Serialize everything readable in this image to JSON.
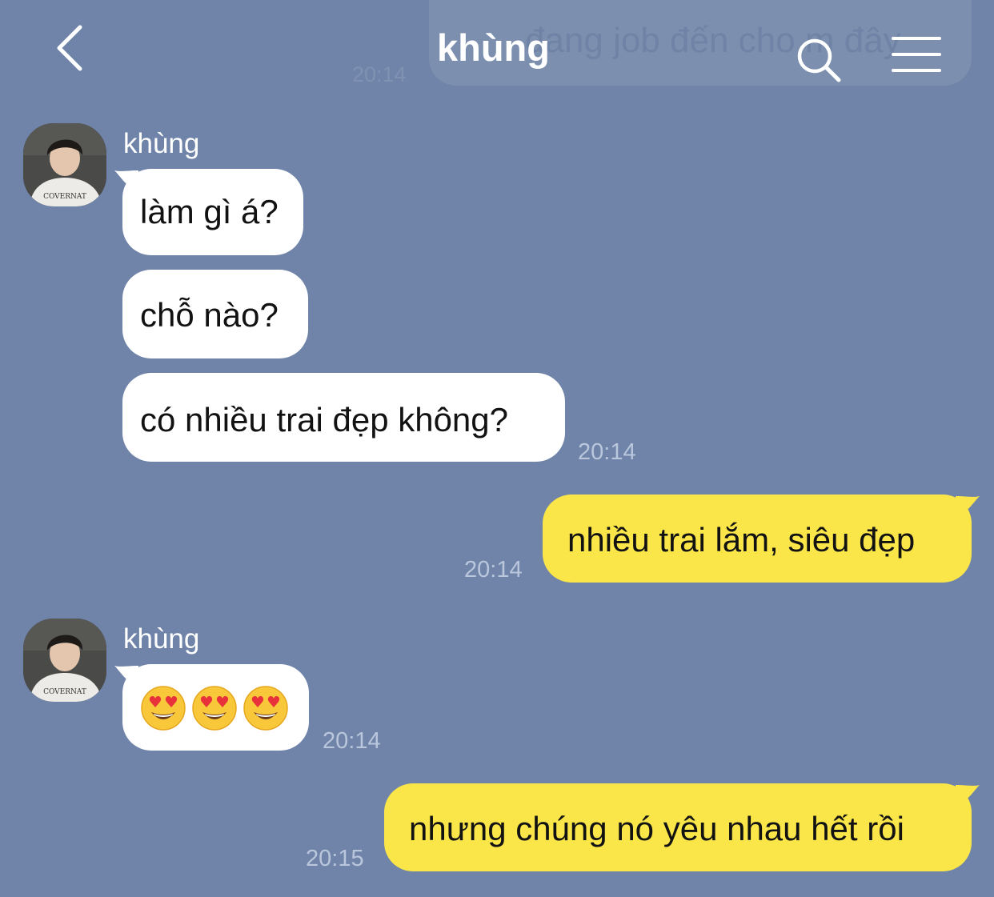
{
  "header": {
    "title": "khùng",
    "pinned_preview_text": "đang job đến cho m đây",
    "pinned_preview_time": "20:14"
  },
  "icons": {
    "back": "chevron-left-icon",
    "search": "search-icon",
    "menu": "hamburger-menu-icon",
    "avatar": "profile-photo",
    "emoji": "heart-eyes-emoji"
  },
  "colors": {
    "background": "#6f84a8",
    "incoming_bubble": "#ffffff",
    "outgoing_bubble": "#fbe64a",
    "timestamp": "#b9c6dc"
  },
  "messages": [
    {
      "sender": "khùng",
      "direction": "incoming",
      "text": "làm gì á?"
    },
    {
      "direction": "incoming",
      "text": "chỗ nào?"
    },
    {
      "direction": "incoming",
      "text": "có nhiều trai đẹp không?",
      "time": "20:14"
    },
    {
      "direction": "outgoing",
      "text": "nhiều trai lắm, siêu đẹp",
      "time": "20:14"
    },
    {
      "sender": "khùng",
      "direction": "incoming",
      "text": "😍😍😍",
      "emoji_count": 3,
      "time": "20:14"
    },
    {
      "direction": "outgoing",
      "text": "nhưng chúng nó yêu nhau hết rồi",
      "time": "20:15"
    }
  ],
  "avatar_shirt_text": "COVERNAT"
}
